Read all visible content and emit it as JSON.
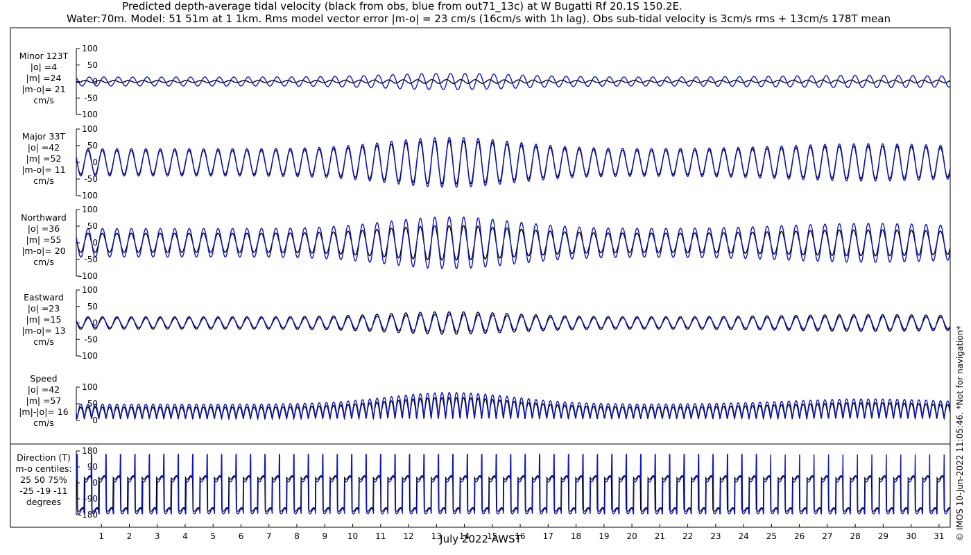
{
  "title_line1": "Predicted depth-average tidal velocity (black from obs, blue from out71_13c) at W Bugatti Rf 20.1S 150.2E.",
  "title_line2": "Water:70m. Model: 51 51m at 1 1km. Rms model vector error |m-o| = 23 cm/s (16cm/s with 1h lag). Obs sub-tidal velocity is 3cm/s rms + 13cm/s 178T mean",
  "copyright": "© IMOS 10-Jun-2022 11:05:46. *Not for navigation*",
  "colors": {
    "obs": "#000000",
    "model": "#0a14c8"
  },
  "chart_data": {
    "type": "line",
    "xlabel": "July 2022 AWST",
    "x_ticks": [
      1,
      2,
      3,
      4,
      5,
      6,
      7,
      8,
      9,
      10,
      11,
      12,
      13,
      14,
      15,
      16,
      17,
      18,
      19,
      20,
      21,
      22,
      23,
      24,
      25,
      26,
      27,
      28,
      29,
      30,
      31
    ],
    "xlim": [
      0.1,
      31.4
    ],
    "series_legend": [
      {
        "name": "obs",
        "color": "#000000"
      },
      {
        "name": "out71_13c",
        "color": "#0a14c8"
      }
    ],
    "panels": [
      {
        "labels": [
          "Minor 123T",
          "|o| =4",
          "|m| =24",
          "|m-o|= 21",
          "cm/s"
        ],
        "ylim": [
          -100,
          100
        ],
        "yticks": [
          -100,
          -50,
          0,
          50,
          100
        ],
        "ytick_labels": [
          "-100",
          "-50",
          "0",
          "50",
          "100"
        ],
        "kind": "tide",
        "obs_amp": 6,
        "model_amp": 25,
        "model_phase": 0.6
      },
      {
        "labels": [
          "Major 33T",
          "|o| =42",
          "|m| =52",
          "|m-o|= 11",
          "cm/s"
        ],
        "ylim": [
          -100,
          100
        ],
        "yticks": [
          -100,
          -50,
          0,
          50,
          100
        ],
        "ytick_labels": [
          "-100",
          "-50",
          "0",
          "50",
          "100"
        ],
        "kind": "tide",
        "obs_amp": 65,
        "model_amp": 75,
        "model_phase": 0.05
      },
      {
        "labels": [
          "Northward",
          "|o| =36",
          "|m| =55",
          "|m-o|= 20",
          "cm/s"
        ],
        "ylim": [
          -100,
          100
        ],
        "yticks": [
          -100,
          -50,
          0,
          50,
          100
        ],
        "ytick_labels": [
          "-100",
          "-50",
          "0",
          "50",
          "100"
        ],
        "kind": "tide",
        "obs_amp": 52,
        "model_amp": 78,
        "model_phase": 0.05
      },
      {
        "labels": [
          "Eastward",
          "|o| =23",
          "|m| =15",
          "|m-o|= 13",
          "cm/s"
        ],
        "ylim": [
          -100,
          100
        ],
        "yticks": [
          -100,
          -50,
          0,
          50,
          100
        ],
        "ytick_labels": [
          "-100",
          "-50",
          "0",
          "50",
          "100"
        ],
        "kind": "tide",
        "obs_amp": 34,
        "model_amp": 26,
        "model_phase": 0.15
      },
      {
        "labels": [
          "Speed",
          "|o| =42",
          "|m| =57",
          "|m|-|o|= 16",
          "cm/s"
        ],
        "ylim": [
          0,
          100
        ],
        "yticks": [
          0,
          50,
          100
        ],
        "ytick_labels": [
          "0",
          "50",
          "100"
        ],
        "kind": "speed",
        "obs_amp": 65,
        "model_amp": 78,
        "model_phase": 0.05
      },
      {
        "labels": [
          "Direction (T)",
          "m-o centiles:",
          "25  50  75%",
          "-25 -19 -11",
          "degrees"
        ],
        "ylim": [
          -180,
          180
        ],
        "yticks": [
          -180,
          -90,
          0,
          90,
          180
        ],
        "ytick_labels": [
          "-180",
          "-90",
          "0",
          "90",
          "180"
        ],
        "kind": "direction",
        "obs_amp": 0,
        "model_amp": 0,
        "model_phase": 0.05
      }
    ]
  }
}
